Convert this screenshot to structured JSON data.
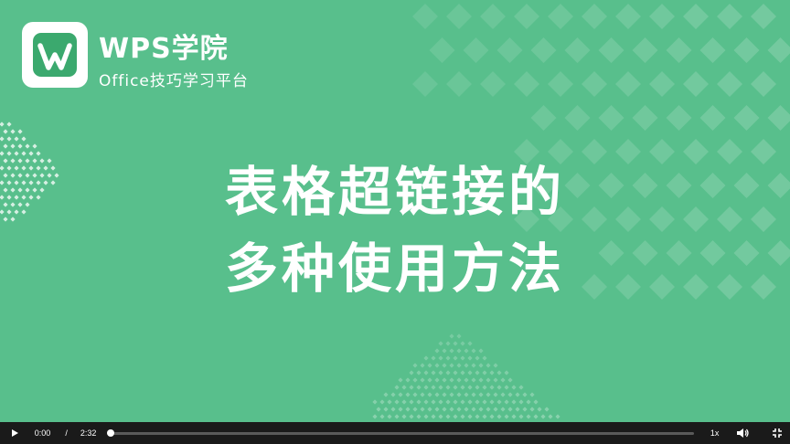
{
  "brand": {
    "title": "WPS学院",
    "subtitle": "Office技巧学习平台",
    "logo_icon": "wps-w-logo-icon"
  },
  "headline": {
    "line1": "表格超链接的",
    "line2": "多种使用方法"
  },
  "player": {
    "current_time": "0:00",
    "separator": "/",
    "duration": "2:32",
    "progress_fraction": 0.0,
    "speed": "1x",
    "icons": {
      "play": "play-icon",
      "volume": "volume-icon",
      "fullscreen": "fullscreen-exit-icon"
    }
  },
  "colors": {
    "background": "#58bf8c",
    "logo_green": "#3ba96e",
    "control_bar": "#1a1a1a",
    "text": "#ffffff"
  }
}
